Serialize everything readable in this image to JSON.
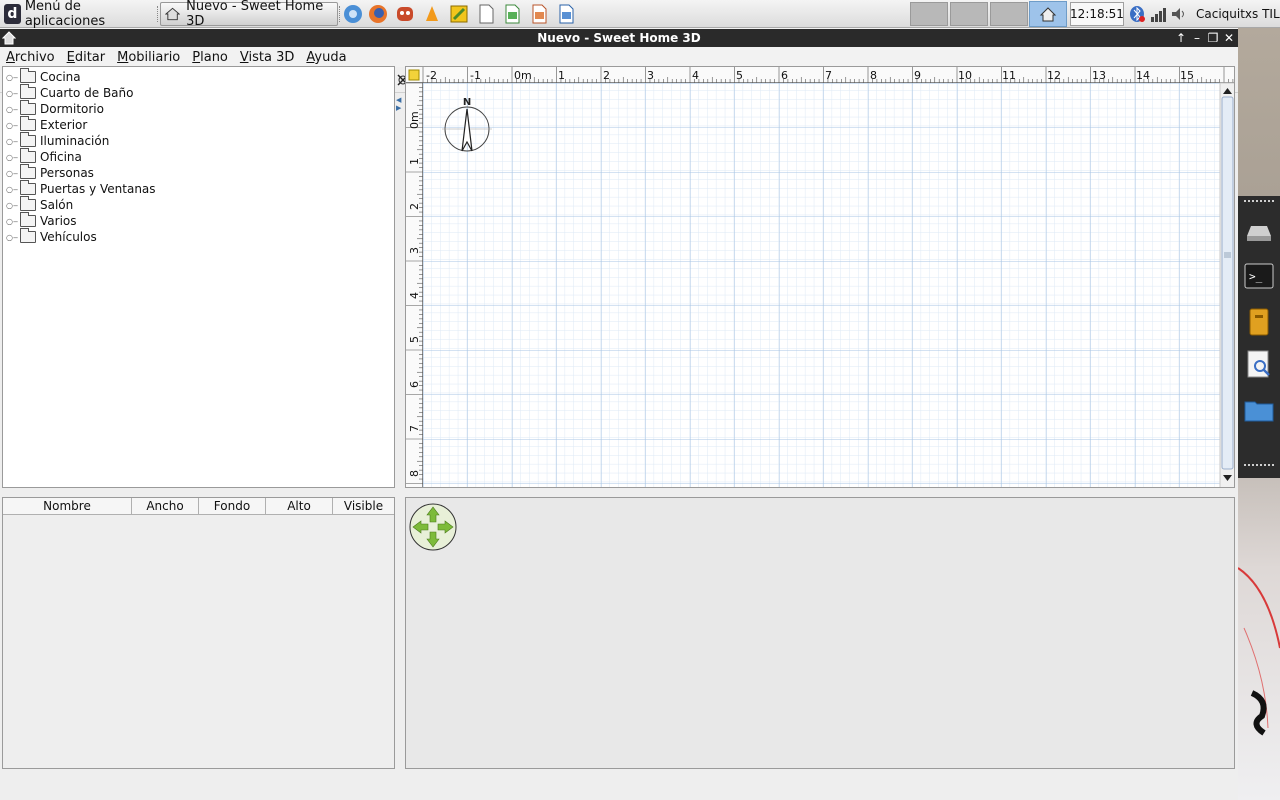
{
  "taskbar": {
    "apps_menu_label": "Menú de aplicaciones",
    "active_task_label": "Nuevo - Sweet Home 3D",
    "clock": "12:18:51",
    "user": "Caciquitxs TIL"
  },
  "window": {
    "title": "Nuevo - Sweet Home 3D"
  },
  "menubar": [
    {
      "label": "Archivo",
      "key": "A",
      "rest": "rchivo"
    },
    {
      "label": "Editar",
      "key": "E",
      "rest": "ditar"
    },
    {
      "label": "Mobiliario",
      "key": "M",
      "rest": "obiliario"
    },
    {
      "label": "Plano",
      "key": "P",
      "rest": "lano"
    },
    {
      "label": "Vista 3D",
      "key": "V",
      "rest": "ista 3D"
    },
    {
      "label": "Ayuda",
      "key": "A",
      "rest": "yuda"
    }
  ],
  "catalog": {
    "categories": [
      "Cocina",
      "Cuarto de Baño",
      "Dormitorio",
      "Exterior",
      "Iluminación",
      "Oficina",
      "Personas",
      "Puertas y Ventanas",
      "Salón",
      "Varios",
      "Vehículos"
    ]
  },
  "furniture_table": {
    "columns": [
      "Nombre",
      "Ancho",
      "Fondo",
      "Alto",
      "Visible"
    ]
  },
  "plan": {
    "h_ruler_labels": [
      "-2",
      "-1",
      "0m",
      "1",
      "2",
      "3",
      "4",
      "5",
      "6",
      "7",
      "8",
      "9",
      "10",
      "11",
      "12",
      "13",
      "14",
      "15"
    ],
    "v_ruler_labels": [
      "0m",
      "1",
      "2",
      "3",
      "4",
      "5",
      "6",
      "7",
      "8"
    ],
    "compass_label": "N"
  },
  "colors": {
    "grid_major": "#a9c6e4",
    "grid_minor": "#dde9f5",
    "titlebar": "#2a2a2a",
    "nav_green": "#7dbb3a"
  }
}
